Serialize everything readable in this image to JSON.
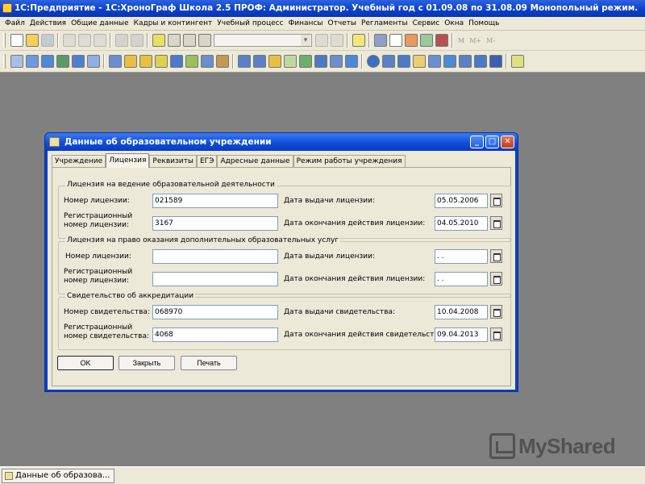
{
  "app": {
    "title": "1С:Предприятие - 1С:ХроноГраф Школа 2.5 ПРОФ: Администратор. Учебный год с 01.09.08 по 31.08.09 Монопольный режим."
  },
  "menu": [
    "Файл",
    "Действия",
    "Общие данные",
    "Кадры и контингент",
    "Учебный процесс",
    "Финансы",
    "Отчеты",
    "Регламенты",
    "Сервис",
    "Окна",
    "Помощь"
  ],
  "toolbar": {
    "text_buttons": [
      "M",
      "M+",
      "M-"
    ]
  },
  "dialog": {
    "title": "Данные об образовательном учреждении",
    "tabs": [
      "Учреждение",
      "Лицензия",
      "Реквизиты",
      "ЕГЭ",
      "Адресные данные",
      "Режим работы учреждения"
    ],
    "active_tab": "Лицензия",
    "license_group": {
      "title": "Лицензия на ведение образовательной деятельности",
      "number_label": "Номер лицензии:",
      "number_value": "021589",
      "reg_label_1": "Регистрационный",
      "reg_label_2": "номер лицензии:",
      "reg_value": "3167",
      "issue_label": "Дата выдачи лицензии:",
      "issue_value": "05.05.2006",
      "end_label": "Дата окончания действия лицензии:",
      "end_value": "04.05.2010"
    },
    "extra_group": {
      "title": "Лицензия на право оказания дополнительных образовательных услуг",
      "number_label": "Номер лицензии:",
      "number_value": "",
      "reg_label_1": "Регистрационный",
      "reg_label_2": "номер лицензии:",
      "reg_value": "",
      "issue_label": "Дата выдачи лицензии:",
      "issue_value": " . .",
      "end_label": "Дата окончания действия лицензии:",
      "end_value": " . ."
    },
    "cert_group": {
      "title": "Свидетельство об аккредитации",
      "number_label": "Номер свидетельства:",
      "number_value": "068970",
      "reg_label_1": "Регистрационный",
      "reg_label_2": "номер свидетельства:",
      "reg_value": "4068",
      "issue_label": "Дата выдачи  свидетельства:",
      "issue_value": "10.04.2008",
      "end_label": "Дата окончания действия  свидетельства:",
      "end_value": "09.04.2013"
    },
    "buttons": {
      "ok": "OK",
      "close": "Закрыть",
      "print": "Печать"
    }
  },
  "taskbar": {
    "item": "Данные об образова..."
  },
  "watermark": {
    "text": "MyShared"
  },
  "colors": {
    "title_bar": "#0a3fc6",
    "workspace": "#808080",
    "dialog_face": "#ece9d8"
  }
}
